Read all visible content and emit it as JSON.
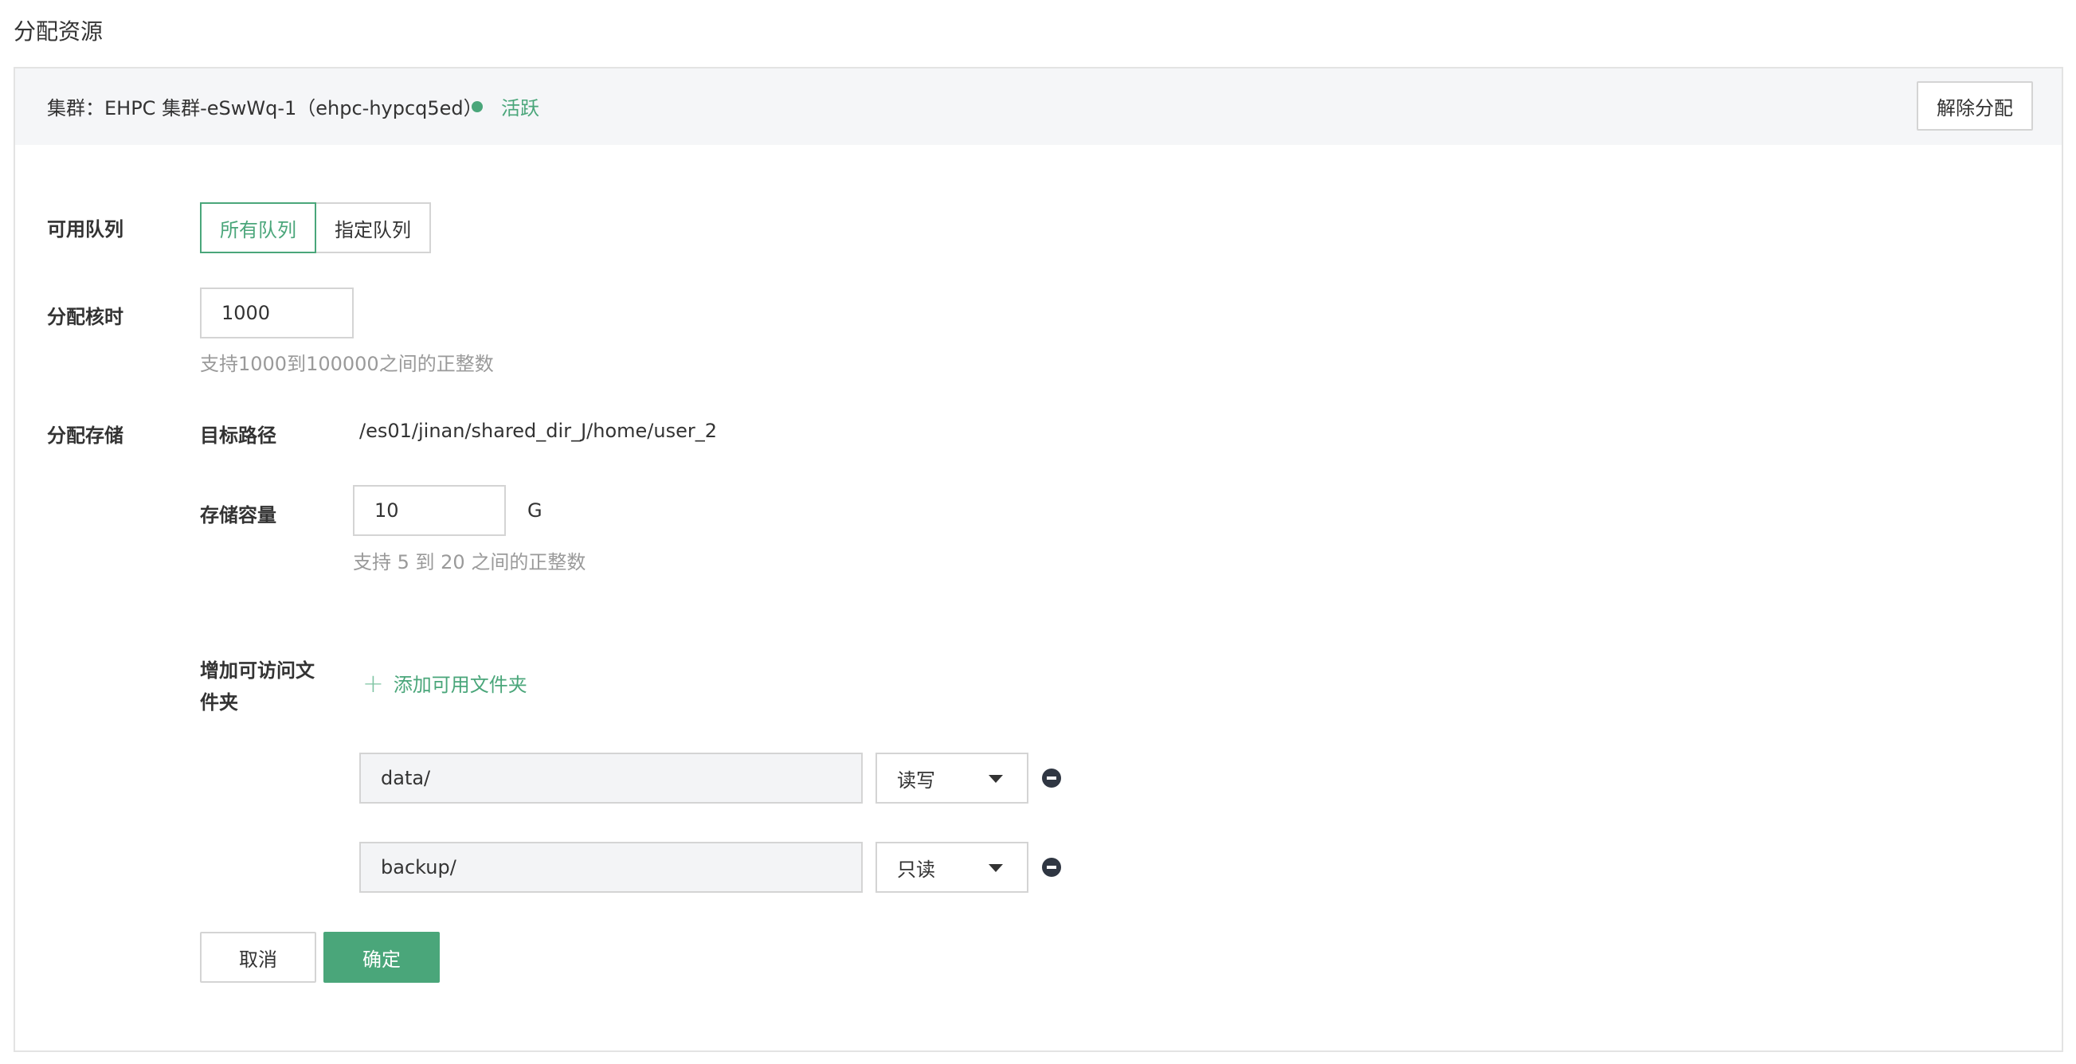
{
  "page": {
    "title": "分配资源"
  },
  "cluster": {
    "label": "集群：EHPC 集群-eSwWq-1（ehpc-hypcq5ed）",
    "status": "活跃",
    "status_color": "#4aa67a",
    "release_button": "解除分配"
  },
  "queues": {
    "label": "可用队列",
    "options": [
      "所有队列",
      "指定队列"
    ],
    "selected": "所有队列"
  },
  "core_hours": {
    "label": "分配核时",
    "value": "1000",
    "hint": "支持1000到100000之间的正整数"
  },
  "storage": {
    "label": "分配存储",
    "target_path_label": "目标路径",
    "target_path": "/es01/jinan/shared_dir_J/home/user_2",
    "capacity_label": "存储容量",
    "capacity_value": "10",
    "capacity_unit": "G",
    "capacity_hint": "支持 5 到 20 之间的正整数"
  },
  "folders": {
    "label": "增加可访问文件夹",
    "add_link": "添加可用文件夹",
    "items": [
      {
        "path": "data/",
        "permission": "读写"
      },
      {
        "path": "backup/",
        "permission": "只读"
      }
    ]
  },
  "actions": {
    "cancel": "取消",
    "confirm": "确定"
  },
  "colors": {
    "accent": "#4aa67a",
    "border": "#d4d4d4",
    "header_bg": "#f5f6f8"
  },
  "icons": [
    "status-dot-icon",
    "plus-icon",
    "caret-down-icon",
    "minus-circle-icon"
  ]
}
